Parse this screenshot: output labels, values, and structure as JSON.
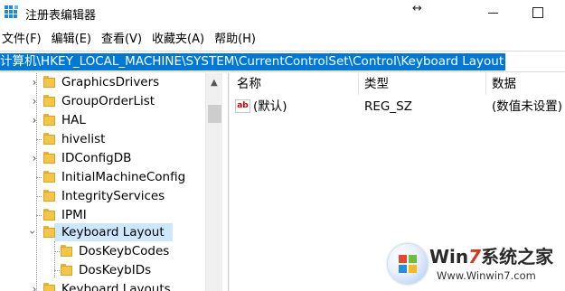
{
  "window": {
    "title": "注册表编辑器",
    "resize_glyph": "↔"
  },
  "menu": [
    "文件(F)",
    "编辑(E)",
    "查看(V)",
    "收藏夹(A)",
    "帮助(H)"
  ],
  "address": "计算机\\HKEY_LOCAL_MACHINE\\SYSTEM\\CurrentControlSet\\Control\\Keyboard Layout",
  "tree": {
    "items": [
      {
        "label": "GraphicsDrivers",
        "expander": "collapsed"
      },
      {
        "label": "GroupOrderList",
        "expander": "collapsed"
      },
      {
        "label": "HAL",
        "expander": "collapsed"
      },
      {
        "label": "hivelist",
        "expander": "none"
      },
      {
        "label": "IDConfigDB",
        "expander": "collapsed"
      },
      {
        "label": "InitialMachineConfig",
        "expander": "none"
      },
      {
        "label": "IntegrityServices",
        "expander": "none"
      },
      {
        "label": "IPMI",
        "expander": "none"
      },
      {
        "label": "Keyboard Layout",
        "expander": "expanded",
        "selected": true
      },
      {
        "label": "DosKeybCodes",
        "expander": "none",
        "child": true
      },
      {
        "label": "DosKeybIDs",
        "expander": "none",
        "child": true
      },
      {
        "label": "Keyboard Layouts",
        "expander": "collapsed"
      }
    ]
  },
  "list": {
    "columns": [
      "名称",
      "类型",
      "数据"
    ],
    "rows": [
      {
        "icon": "string-value-icon",
        "icon_text": "ab",
        "name": "(默认)",
        "type": "REG_SZ",
        "data": "(数值未设置)"
      }
    ]
  },
  "watermark": {
    "brand_prefix": "Win",
    "brand_accent": "7",
    "brand_suffix": "系统之家",
    "url": "Www.Winwin7.com"
  },
  "colors": {
    "selection": "#0078d7",
    "tree_selection": "#cce8ff",
    "folder": "#f5c645"
  }
}
